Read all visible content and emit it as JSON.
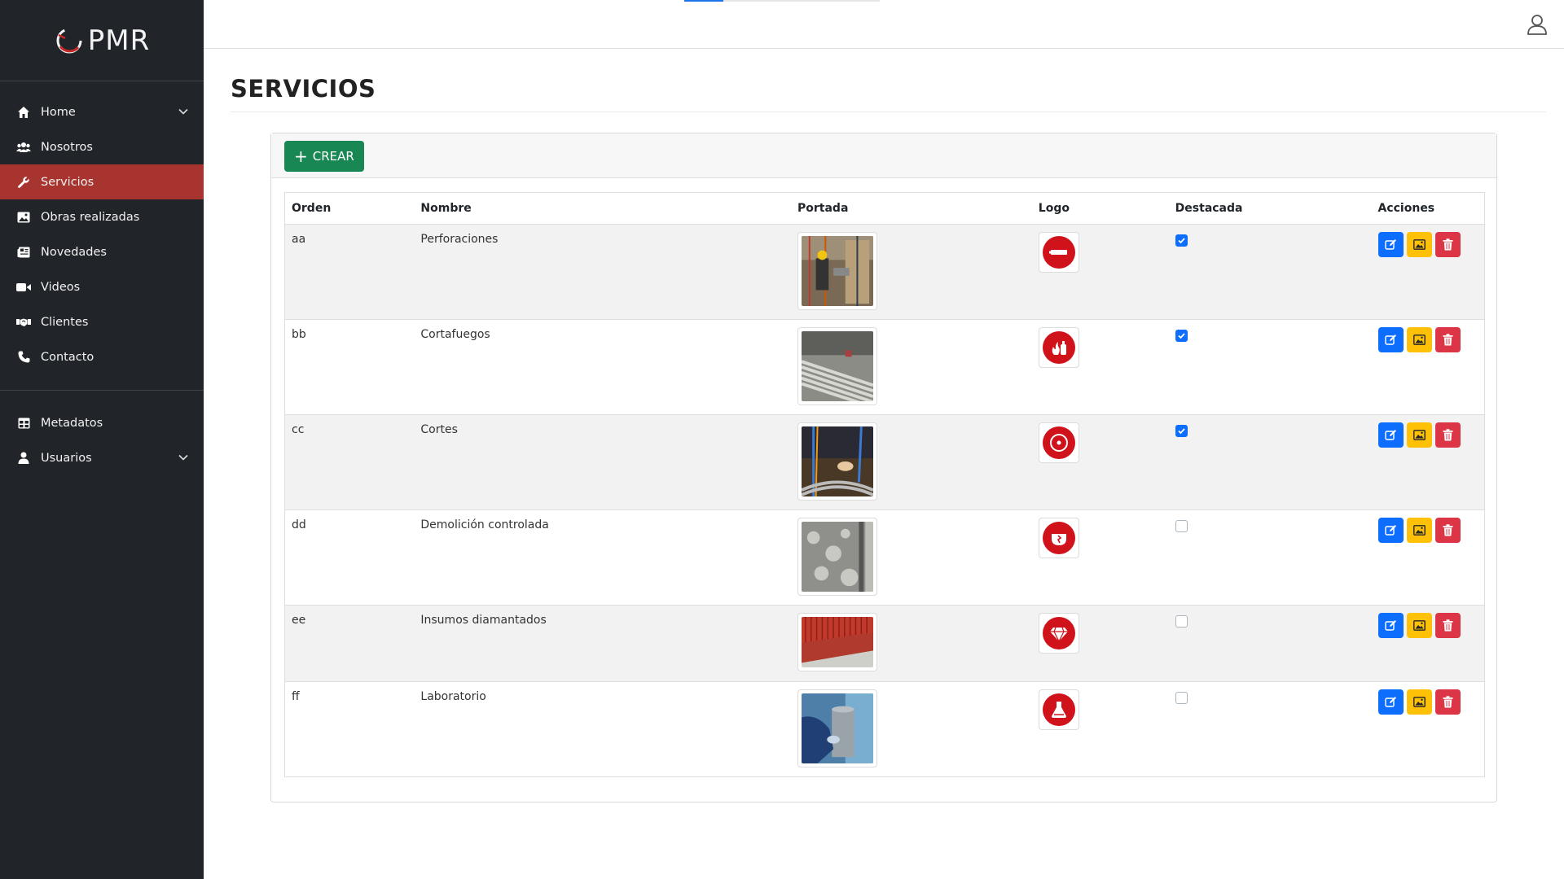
{
  "brand": {
    "logo_text": "PMR"
  },
  "sidebar": {
    "items": [
      {
        "label": "Home",
        "icon": "house-icon",
        "has_chevron": true
      },
      {
        "label": "Nosotros",
        "icon": "users-icon"
      },
      {
        "label": "Servicios",
        "icon": "wrench-icon",
        "active": true
      },
      {
        "label": "Obras realizadas",
        "icon": "image-icon"
      },
      {
        "label": "Novedades",
        "icon": "newspaper-icon"
      },
      {
        "label": "Videos",
        "icon": "video-icon"
      },
      {
        "label": "Clientes",
        "icon": "handshake-icon"
      },
      {
        "label": "Contacto",
        "icon": "phone-icon"
      }
    ],
    "items2": [
      {
        "label": "Metadatos",
        "icon": "table-icon"
      },
      {
        "label": "Usuarios",
        "icon": "user-icon",
        "has_chevron": true
      }
    ]
  },
  "page": {
    "title": "SERVICIOS"
  },
  "toolbar": {
    "create_label": "CREAR"
  },
  "table": {
    "headers": {
      "orden": "Orden",
      "nombre": "Nombre",
      "portada": "Portada",
      "logo": "Logo",
      "destacada": "Destacada",
      "acciones": "Acciones"
    },
    "rows": [
      {
        "orden": "aa",
        "nombre": "Perforaciones",
        "destacada": true,
        "logo_icon": "drill-icon"
      },
      {
        "orden": "bb",
        "nombre": "Cortafuegos",
        "destacada": true,
        "logo_icon": "fire-extinguisher-icon"
      },
      {
        "orden": "cc",
        "nombre": "Cortes",
        "destacada": true,
        "logo_icon": "saw-disc-icon"
      },
      {
        "orden": "dd",
        "nombre": "Demolición controlada",
        "destacada": false,
        "logo_icon": "broken-wall-icon"
      },
      {
        "orden": "ee",
        "nombre": "Insumos diamantados",
        "destacada": false,
        "logo_icon": "diamond-icon"
      },
      {
        "orden": "ff",
        "nombre": "Laboratorio",
        "destacada": false,
        "logo_icon": "flask-icon"
      }
    ]
  },
  "colors": {
    "sidebar_bg": "#212529",
    "active_item": "#a8342f",
    "create_btn": "#198754",
    "edit_btn": "#0d6efd",
    "image_btn": "#ffc107",
    "delete_btn": "#dc3545",
    "logo_red": "#d0121b"
  },
  "loading_progress": 0.2
}
